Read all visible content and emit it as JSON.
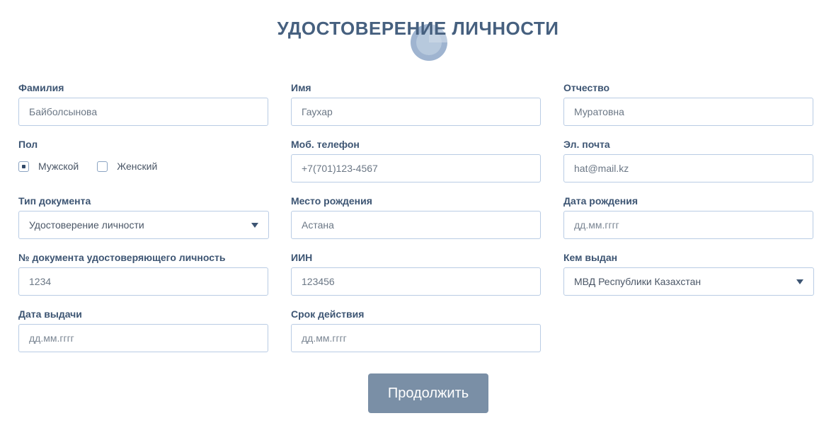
{
  "page": {
    "title": "УДОСТОВЕРЕНИЕ ЛИЧНОСТИ"
  },
  "form": {
    "surname": {
      "label": "Фамилия",
      "value": "Байболсынова"
    },
    "name": {
      "label": "Имя",
      "value": "Гаухар"
    },
    "patronymic": {
      "label": "Отчество",
      "value": "Муратовна"
    },
    "gender": {
      "label": "Пол",
      "options": [
        {
          "label": "Мужской",
          "selected": true
        },
        {
          "label": "Женский",
          "selected": false
        }
      ]
    },
    "phone": {
      "label": "Моб. телефон",
      "value": "+7(701)123-4567"
    },
    "email": {
      "label": "Эл. почта",
      "value": "hat@mail.kz"
    },
    "doc_type": {
      "label": "Тип документа",
      "value": "Удостоверение личности"
    },
    "birthplace": {
      "label": "Место рождения",
      "value": "Астана"
    },
    "birthdate": {
      "label": "Дата рождения",
      "placeholder": "дд.мм.гггг"
    },
    "doc_number": {
      "label": "№ документа удостоверяющего личность",
      "value": "1234"
    },
    "iin": {
      "label": "ИИН",
      "value": "123456"
    },
    "issued_by": {
      "label": "Кем выдан",
      "value": "МВД Республики Казахстан"
    },
    "issue_date": {
      "label": "Дата выдачи",
      "placeholder": "дд.мм.гггг"
    },
    "expiry_date": {
      "label": "Срок действия",
      "placeholder": "дд.мм.гггг"
    }
  },
  "actions": {
    "continue_label": "Продолжить"
  },
  "colors": {
    "text": "#3d5573",
    "border": "#b9cce4",
    "button": "#7a8fa6"
  },
  "icons": {
    "loading": "loading-spinner-icon",
    "dropdown": "caret-down-icon"
  }
}
